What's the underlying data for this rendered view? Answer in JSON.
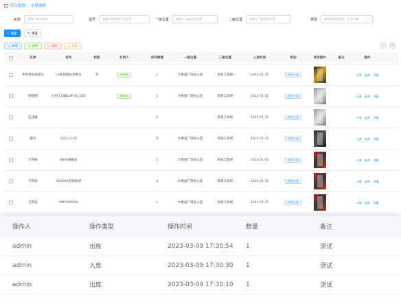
{
  "breadcrumb": {
    "section": "库存管理",
    "current": "全局搜索"
  },
  "filters": {
    "name": {
      "label": "名称",
      "placeholder": "请输入库存名称"
    },
    "model": {
      "label": "型号",
      "placeholder": "请输入库件或产品型号"
    },
    "pos1": {
      "label": "一级位置",
      "placeholder": "请输入上级存放位置"
    },
    "pos2": {
      "label": "二级位置",
      "placeholder": "请输入下级存放位置"
    },
    "category": {
      "label": "类别",
      "placeholder": "请选择类型类别，区分归属"
    }
  },
  "actions": {
    "search": "搜索",
    "reset": "重置"
  },
  "toolbar": {
    "add": "新增",
    "edit": "修改",
    "delete": "删除",
    "export": "导出"
  },
  "main_table": {
    "headers": [
      "名称",
      "型号",
      "封装",
      "负责人",
      "库存数量",
      "一级位置",
      "二级位置",
      "入库时间",
      "类别",
      "库存图片",
      "备注",
      "操作"
    ],
    "rows": [
      {
        "name": "手持激光测距仪",
        "model": "LS系列激光测距仪",
        "pack": "无",
        "owner": "李恒杰",
        "qty": "1",
        "pos1": "大楼油广场办公室",
        "pos2": "研发工具柜",
        "date": "2023-01-31",
        "category": "研发工具",
        "thumb": "yellow",
        "note": "",
        "ops": [
          "入库",
          "出库",
          "详情"
        ]
      },
      {
        "name": "网络钳",
        "model": "FOR COND 8P 8C USE",
        "pack": "",
        "owner": "陈耿彬",
        "qty": "1",
        "pos1": "大楼油广场办公室",
        "pos2": "研发工具柜",
        "date": "2023-01-31",
        "category": "研发工具",
        "thumb": "light",
        "note": "",
        "ops": [
          "入库",
          "出库",
          "详情"
        ]
      },
      {
        "name": "压线器",
        "model": "",
        "pack": "",
        "owner": "",
        "qty": "2",
        "pos1": "",
        "pos2": "研发工具柜",
        "date": "2023-01-31",
        "category": "研发工具",
        "thumb": "light",
        "note": "",
        "ops": [
          "入库",
          "出库",
          "详情"
        ]
      },
      {
        "name": "镊子",
        "model": "ESD-12-15",
        "pack": "",
        "owner": "",
        "qty": "6",
        "pos1": "大楼油广场办公室",
        "pos2": "研发工具柜",
        "date": "2023-01-31",
        "category": "研发工具",
        "thumb": "dark",
        "note": "",
        "ops": [
          "入库",
          "出库",
          "详情"
        ]
      },
      {
        "name": "万用表",
        "model": "890F通番式",
        "pack": "",
        "owner": "",
        "qty": "1",
        "pos1": "大楼油广场办公室",
        "pos2": "研发工具柜",
        "date": "2023-01-31",
        "category": "研发工具",
        "thumb": "red",
        "note": "",
        "ops": [
          "入库",
          "出库",
          "详情"
        ]
      },
      {
        "name": "万用表",
        "model": "SK166A智能防烧",
        "pack": "",
        "owner": "",
        "qty": "1",
        "pos1": "大楼油广场办公室",
        "pos2": "研发工具柜",
        "date": "2023-01-31",
        "category": "研发工具",
        "thumb": "red",
        "note": "",
        "ops": [
          "入库",
          "出库",
          "详情"
        ]
      },
      {
        "name": "万用表",
        "model": "MNT000058",
        "pack": "",
        "owner": "",
        "qty": "1",
        "pos1": "大楼油广场办公室",
        "pos2": "研发工具柜",
        "date": "2023-01-31",
        "category": "研发工具",
        "thumb": "red",
        "note": "",
        "ops": [
          "入库",
          "出库",
          "详情"
        ]
      }
    ]
  },
  "log_table": {
    "headers": [
      "操作人",
      "操作类型",
      "操作时间",
      "数量",
      "备注"
    ],
    "rows": [
      {
        "user": "admin",
        "type": "出库",
        "time": "2023-03-09 17:30:54",
        "qty": "1",
        "note": "测试"
      },
      {
        "user": "admin",
        "type": "入库",
        "time": "2023-03-09 17:30:30",
        "qty": "1",
        "note": "测试"
      },
      {
        "user": "admin",
        "type": "出库",
        "time": "2023-03-09 17:30:10",
        "qty": "1",
        "note": "测试"
      }
    ]
  }
}
